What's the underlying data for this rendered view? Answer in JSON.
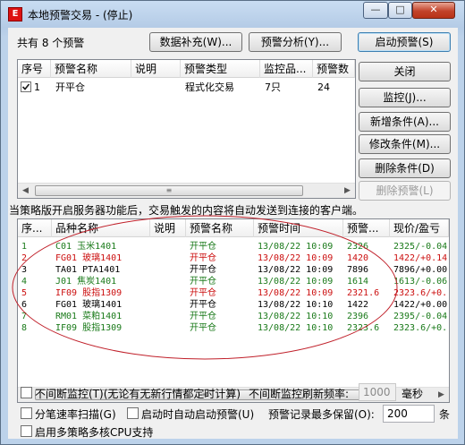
{
  "window": {
    "title": "本地预警交易 - (停止)",
    "min_glyph": "—",
    "max_glyph": "□",
    "close_glyph": "✕"
  },
  "top": {
    "count_label": "共有 8 个预警",
    "data_fill_button": "数据补充(W)...",
    "analysis_button": "预警分析(Y)..."
  },
  "side_buttons": {
    "start": "启动预警(S)",
    "close": "关闭",
    "monitor": "监控(J)...",
    "add_condition": "新增条件(A)...",
    "edit_condition": "修改条件(M)...",
    "delete_condition": "删除条件(D)",
    "delete_alert": "删除预警(L)"
  },
  "conditions": {
    "headers": [
      "序号",
      "预警名称",
      "说明",
      "预警类型",
      "监控品...",
      "预警数"
    ],
    "rows": [
      {
        "no": "1",
        "name": "开平仓",
        "desc": "",
        "type": "程式化交易",
        "monitor": "7只",
        "alert_count": "24",
        "checked": true
      }
    ]
  },
  "notice": "当策略版开启服务器功能后，交易触发的内容将自动发送到连接的客户端。",
  "alerts": {
    "headers": [
      "序...",
      "品种名称",
      "说明",
      "预警名称",
      "预警时间",
      "预警...",
      "现价/盈亏"
    ],
    "rows": [
      {
        "no": "1",
        "product": "C01 玉米1401",
        "desc": "",
        "name": "开平仓",
        "time": "13/08/22 10:09",
        "price": "2326",
        "current": "2325/-0.04",
        "color": "green"
      },
      {
        "no": "2",
        "product": "FG01 玻璃1401",
        "desc": "",
        "name": "开平仓",
        "time": "13/08/22 10:09",
        "price": "1420",
        "current": "1422/+0.14",
        "color": "red"
      },
      {
        "no": "3",
        "product": "TA01 PTA1401",
        "desc": "",
        "name": "开平仓",
        "time": "13/08/22 10:09",
        "price": "7896",
        "current": "7896/+0.00",
        "color": "black"
      },
      {
        "no": "4",
        "product": "J01 焦炭1401",
        "desc": "",
        "name": "开平仓",
        "time": "13/08/22 10:09",
        "price": "1614",
        "current": "1613/-0.06",
        "color": "green"
      },
      {
        "no": "5",
        "product": "IF09 股指1309",
        "desc": "",
        "name": "开平仓",
        "time": "13/08/22 10:09",
        "price": "2321.6",
        "current": "2323.6/+0.",
        "color": "red"
      },
      {
        "no": "6",
        "product": "FG01 玻璃1401",
        "desc": "",
        "name": "开平仓",
        "time": "13/08/22 10:10",
        "price": "1422",
        "current": "1422/+0.00",
        "color": "black"
      },
      {
        "no": "7",
        "product": "RM01 菜粕1401",
        "desc": "",
        "name": "开平仓",
        "time": "13/08/22 10:10",
        "price": "2396",
        "current": "2395/-0.04",
        "color": "green"
      },
      {
        "no": "8",
        "product": "IF09 股指1309",
        "desc": "",
        "name": "开平仓",
        "time": "13/08/22 10:10",
        "price": "2323.6",
        "current": "2323.6/+0.",
        "color": "green"
      }
    ]
  },
  "options": {
    "uninterrupted_label": "不间断监控(T)(无论有无新行情都定时计算)",
    "refresh_rate_label": "不间断监控刷新频率:",
    "refresh_rate_value": "1000",
    "refresh_rate_unit": "毫秒",
    "tick_scan_label": "分笔速率扫描(G)",
    "auto_start_label": "启动时自动启动预警(U)",
    "max_records_label": "预警记录最多保留(O):",
    "max_records_value": "200",
    "max_records_unit": "条",
    "multicore_label": "启用多策略多核CPU支持"
  },
  "colors": {
    "green": "#1a7a1a",
    "red": "#cc1010",
    "black": "#000000",
    "annotation": "#c0202a"
  }
}
